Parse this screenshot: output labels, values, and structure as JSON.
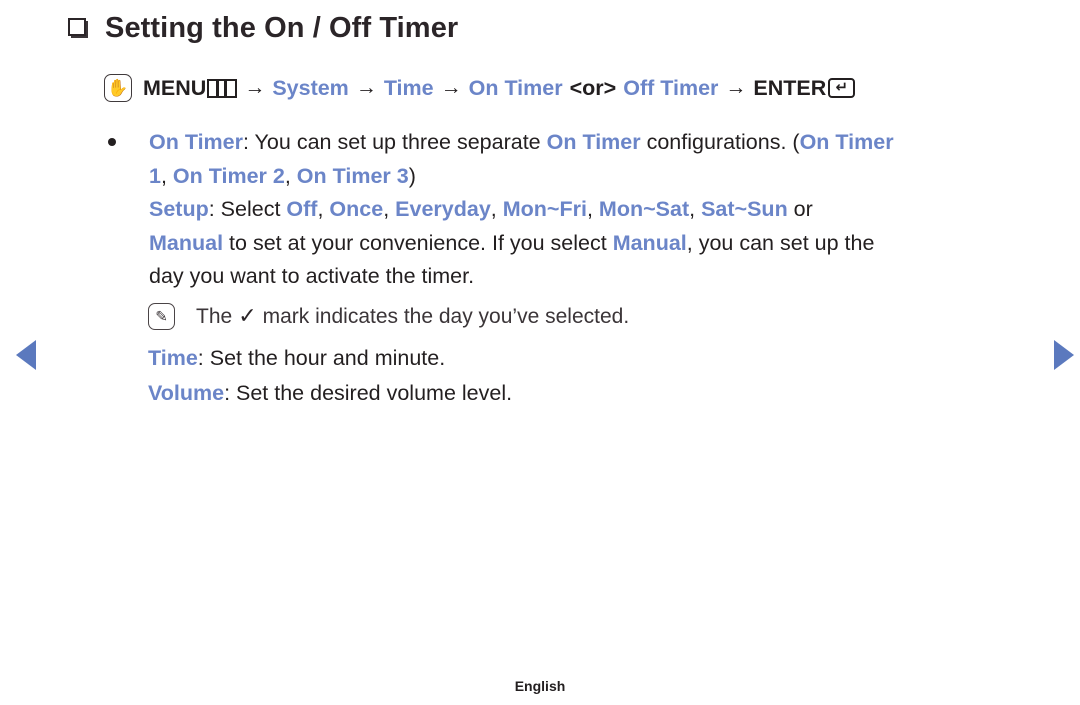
{
  "page": {
    "title": "Setting the On / Off Timer",
    "title_bullet_icon": "square-bullet-icon",
    "footer_language": "English"
  },
  "menu_path": {
    "touch_icon": "hand-touch-icon",
    "menu_label": "MENU",
    "menu_glyph_icon": "menu-bars-icon",
    "arrow": "→",
    "steps": [
      {
        "label": "System",
        "style": "blue"
      },
      {
        "label": "Time",
        "style": "blue"
      },
      {
        "label": "On Timer",
        "style": "blue"
      },
      {
        "label": "<or>",
        "style": "black"
      },
      {
        "label": "Off Timer",
        "style": "blue"
      }
    ],
    "enter_label": "ENTER",
    "enter_glyph_icon": "enter-key-icon",
    "enter_glyph_char": "↵"
  },
  "body": {
    "bullet_icon": "round-bullet-icon",
    "line1": {
      "t1": "On Timer",
      "t2": ": You can set up three separate ",
      "t3": "On Timer",
      "t4": " configurations. (",
      "t5": "On Timer"
    },
    "line2": {
      "t1": "1",
      "t2": ", ",
      "t3": "On Timer 2",
      "t4": ", ",
      "t5": "On Timer 3",
      "t6": ")"
    },
    "line3": {
      "t1": "Setup",
      "t2": ": Select ",
      "t3": "Off",
      "t4": ", ",
      "t5": "Once",
      "t6": ", ",
      "t7": "Everyday",
      "t8": ", ",
      "t9": "Mon~Fri",
      "t10": ", ",
      "t11": "Mon~Sat",
      "t12": ", ",
      "t13": "Sat~Sun",
      "t14": " or"
    },
    "line4": {
      "t1": "Manual",
      "t2": " to set at your convenience. If you select ",
      "t3": "Manual",
      "t4": ", you can set up the"
    },
    "line5": {
      "t1": "day you want to activate the timer."
    }
  },
  "note": {
    "icon": "note-pencil-icon",
    "prefix": "The",
    "check_mark": "✓",
    "suffix": "mark indicates the day you’ve selected."
  },
  "time_line": {
    "label": "Time",
    "text": ": Set the hour and minute."
  },
  "volume_line": {
    "label": "Volume",
    "text": ": Set the desired volume level."
  },
  "nav": {
    "prev_icon": "prev-page-arrow-icon",
    "next_icon": "next-page-arrow-icon"
  },
  "colors": {
    "accent_blue": "#6b85c8",
    "nav_blue": "#5b79be",
    "text_black": "#231f20"
  }
}
